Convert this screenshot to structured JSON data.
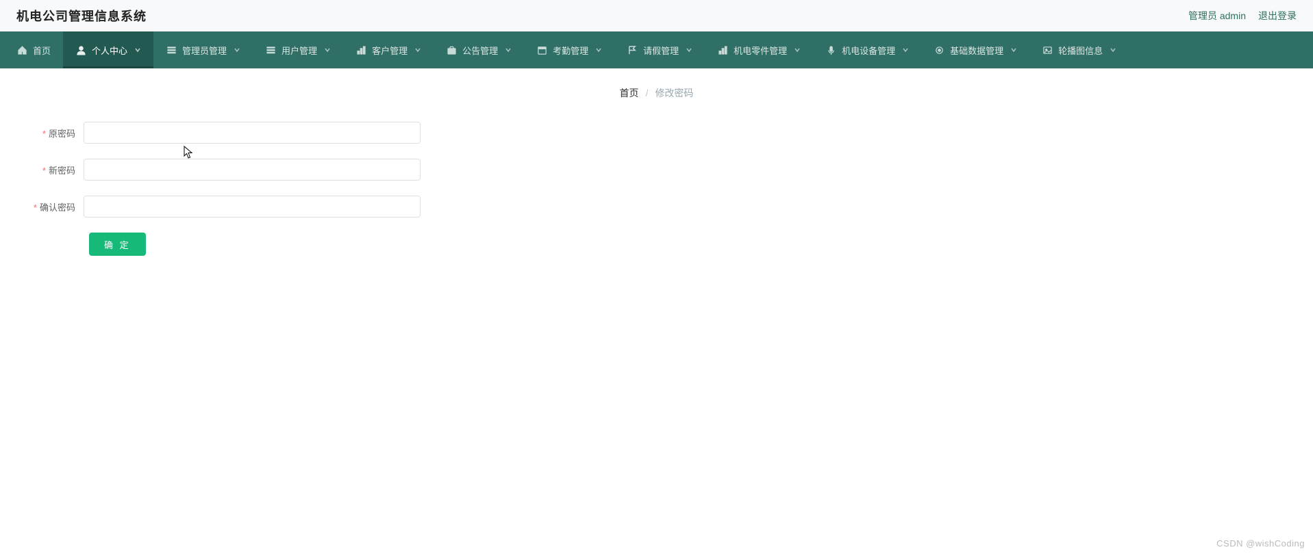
{
  "header": {
    "app_title": "机电公司管理信息系统",
    "admin_label": "管理员 admin",
    "logout_label": "退出登录"
  },
  "nav": {
    "items": [
      {
        "icon": "home",
        "label": "首页",
        "caret": false,
        "active": false
      },
      {
        "icon": "user",
        "label": "个人中心",
        "caret": true,
        "active": true
      },
      {
        "icon": "list",
        "label": "管理员管理",
        "caret": true,
        "active": false
      },
      {
        "icon": "list",
        "label": "用户管理",
        "caret": true,
        "active": false
      },
      {
        "icon": "chart",
        "label": "客户管理",
        "caret": true,
        "active": false
      },
      {
        "icon": "briefcase",
        "label": "公告管理",
        "caret": true,
        "active": false
      },
      {
        "icon": "calendar",
        "label": "考勤管理",
        "caret": true,
        "active": false
      },
      {
        "icon": "flag",
        "label": "请假管理",
        "caret": true,
        "active": false
      },
      {
        "icon": "chart",
        "label": "机电零件管理",
        "caret": true,
        "active": false
      },
      {
        "icon": "mic",
        "label": "机电设备管理",
        "caret": true,
        "active": false
      },
      {
        "icon": "gear",
        "label": "基础数据管理",
        "caret": true,
        "active": false
      },
      {
        "icon": "image",
        "label": "轮播图信息",
        "caret": true,
        "active": false
      }
    ]
  },
  "breadcrumb": {
    "home": "首页",
    "sep": "/",
    "current": "修改密码"
  },
  "form": {
    "old_pwd_label": "原密码",
    "new_pwd_label": "新密码",
    "confirm_pwd_label": "确认密码",
    "old_pwd_value": "",
    "new_pwd_value": "",
    "confirm_pwd_value": "",
    "submit_label": "确 定"
  },
  "watermark": "CSDN @wishCoding"
}
